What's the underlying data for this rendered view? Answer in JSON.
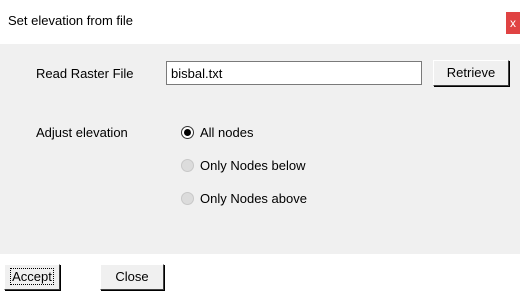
{
  "window": {
    "title": "Set elevation from file",
    "close_glyph": "x"
  },
  "raster": {
    "label": "Read Raster File",
    "value": "bisbal.txt",
    "retrieve_label": "Retrieve"
  },
  "adjust": {
    "label": "Adjust elevation",
    "options": [
      {
        "label": "All nodes",
        "selected": true
      },
      {
        "label": "Only Nodes below",
        "selected": false
      },
      {
        "label": "Only Nodes above",
        "selected": false
      }
    ]
  },
  "footer": {
    "accept_label": "Accept",
    "close_label": "Close"
  },
  "colors": {
    "close_button": "#e04343",
    "panel": "#f0f0f0"
  }
}
